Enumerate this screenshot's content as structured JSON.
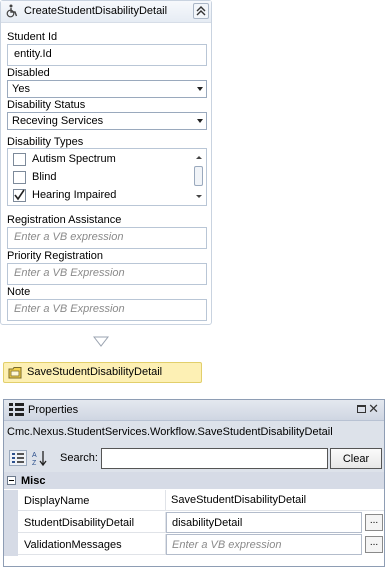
{
  "activity": {
    "title": "CreateStudentDisabilityDetail",
    "icon": "wheelchair-icon",
    "fields": {
      "student_id": {
        "label": "Student Id",
        "value": "entity.Id"
      },
      "disabled": {
        "label": "Disabled",
        "value": "Yes"
      },
      "disability_status": {
        "label": "Disability Status",
        "value": "Receving Services"
      },
      "disability_types": {
        "label": "Disability Types",
        "options": [
          {
            "label": "Autism Spectrum",
            "checked": false
          },
          {
            "label": "Blind",
            "checked": false
          },
          {
            "label": "Hearing Impaired",
            "checked": true
          }
        ]
      },
      "registration_assistance": {
        "label": "Registration Assistance",
        "placeholder": "Enter a VB expression"
      },
      "priority_registration": {
        "label": "Priority Registration",
        "placeholder": "Enter a VB Expression"
      },
      "note": {
        "label": "Note",
        "placeholder": "Enter a VB Expression"
      }
    }
  },
  "next_activity": {
    "title": "SaveStudentDisabilityDetail",
    "icon": "folder-icon"
  },
  "properties": {
    "title": "Properties",
    "type_name": "Cmc.Nexus.StudentServices.Workflow.SaveStudentDisabilityDetail",
    "search_label": "Search:",
    "search_value": "",
    "clear_label": "Clear",
    "category": "Misc",
    "rows": [
      {
        "name": "DisplayName",
        "value": "SaveStudentDisabilityDetail"
      },
      {
        "name": "StudentDisabilityDetail",
        "value": "disabilityDetail"
      },
      {
        "name": "ValidationMessages",
        "placeholder": "Enter a VB expression"
      }
    ],
    "ellipsis_label": "..."
  }
}
